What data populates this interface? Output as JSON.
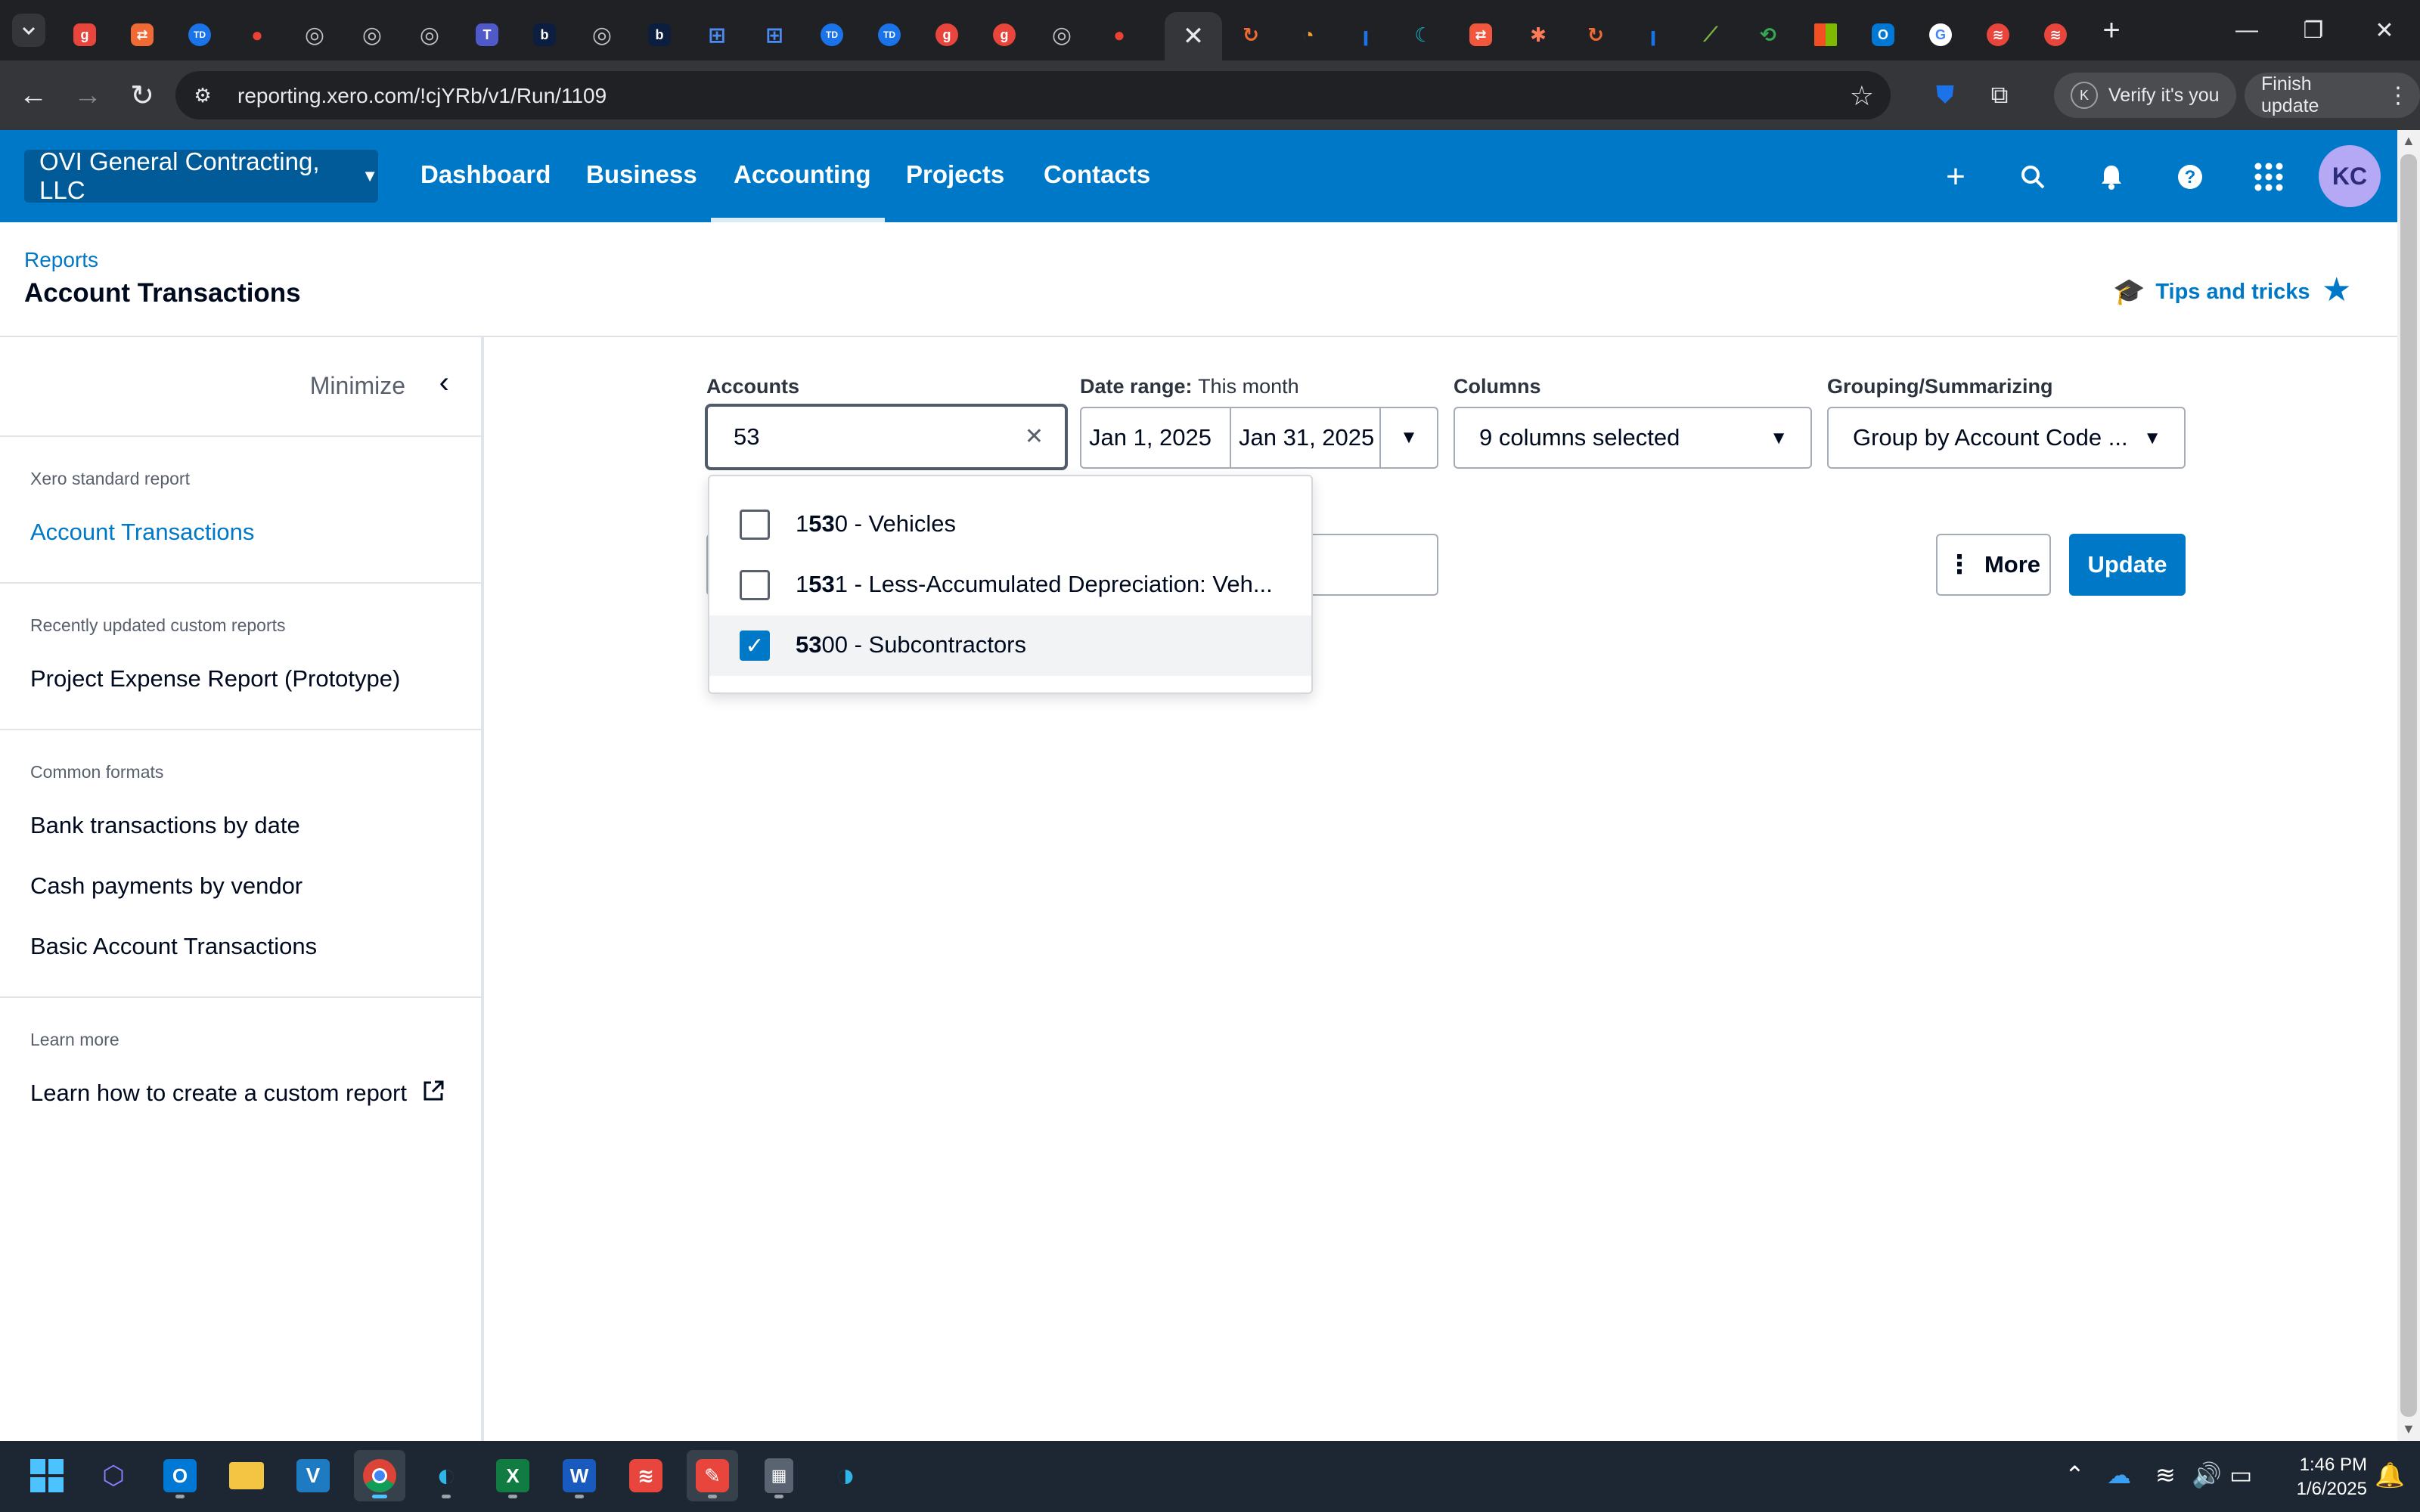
{
  "browser": {
    "url": "reporting.xero.com/!cjYRb/v1/Run/1109",
    "verify_label": "Verify it's you",
    "verify_avatar": "K",
    "finish_update_label": "Finish update"
  },
  "xero_nav": {
    "org_name": "OVI General Contracting, LLC",
    "links": [
      "Dashboard",
      "Business",
      "Accounting",
      "Projects",
      "Contacts"
    ],
    "active_link": "Accounting",
    "avatar_initials": "KC"
  },
  "page": {
    "breadcrumb": "Reports",
    "title": "Account Transactions",
    "tips_label": "Tips and tricks"
  },
  "sidebar": {
    "minimize_label": "Minimize",
    "sections": [
      {
        "caption": "Xero standard report",
        "items": [
          "Account Transactions"
        ]
      },
      {
        "caption": "Recently updated custom reports",
        "items": [
          "Project Expense Report (Prototype)"
        ]
      },
      {
        "caption": "Common formats",
        "items": [
          "Bank transactions by date",
          "Cash payments by vendor",
          "Basic Account Transactions"
        ]
      },
      {
        "caption": "Learn more",
        "items": [
          "Learn how to create a custom report"
        ]
      }
    ]
  },
  "filters": {
    "accounts_label": "Accounts",
    "accounts_value": "53",
    "date_range_label": "Date range:",
    "date_range_preset": "This month",
    "date_from": "Jan 1, 2025",
    "date_to": "Jan 31, 2025",
    "columns_label": "Columns",
    "columns_value": "9 columns selected",
    "grouping_label": "Grouping/Summarizing",
    "grouping_value": "Group by Account Code ...",
    "more_label": "More",
    "update_label": "Update"
  },
  "account_options": [
    {
      "pre": "1",
      "match": "53",
      "post": "0 - Vehicles",
      "checked": false
    },
    {
      "pre": "1",
      "match": "53",
      "post": "1 - Less-Accumulated Depreciation: Veh...",
      "checked": false
    },
    {
      "pre": "",
      "match": "53",
      "post": "00 - Subcontractors",
      "checked": true
    }
  ],
  "taskbar": {
    "time": "1:46 PM",
    "date": "1/6/2025"
  },
  "colors": {
    "xero_blue": "#0078c8",
    "browser_dark": "#202124",
    "taskbar": "#1c2733"
  }
}
